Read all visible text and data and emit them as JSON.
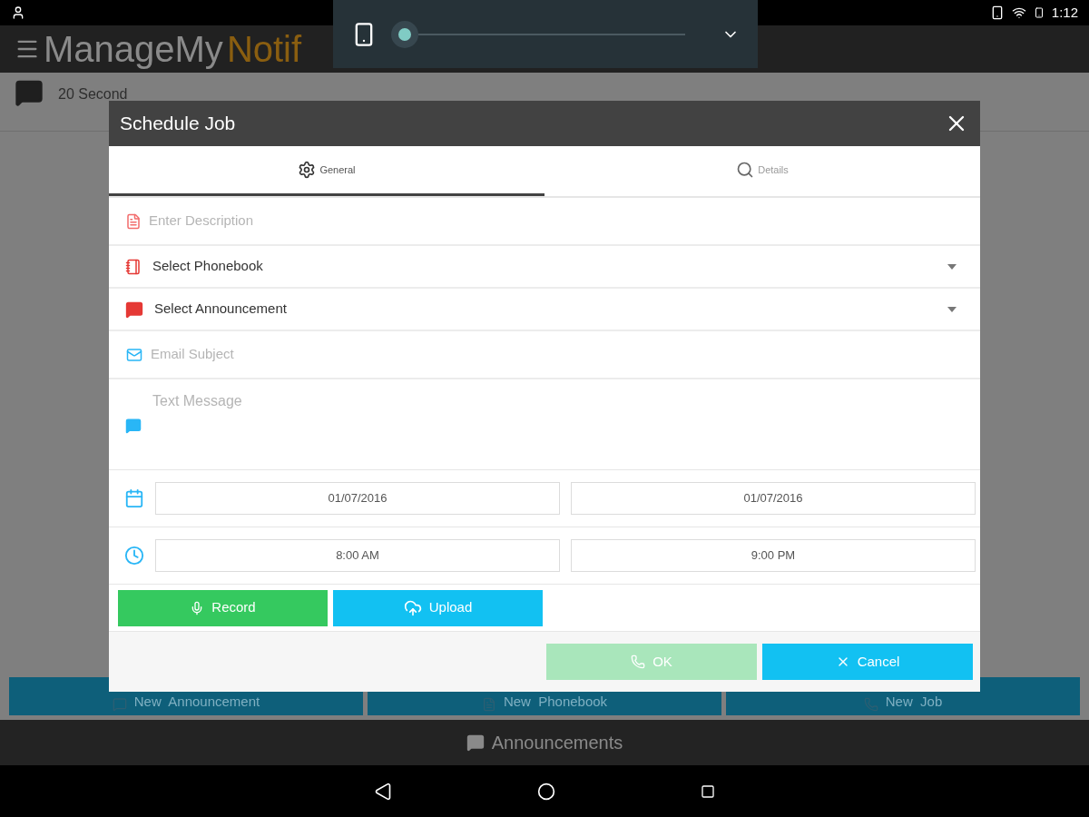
{
  "status_bar": {
    "time": "1:12"
  },
  "volume_panel": {
    "level": 0
  },
  "app_bar": {
    "title_part_1": "ManageMy",
    "title_part_2": "Notif"
  },
  "list": [
    {
      "text": "20 Second"
    }
  ],
  "actions": [
    {
      "kind": "announcement",
      "label": "New  Announcement"
    },
    {
      "kind": "phonebook",
      "label": "New  Phonebook"
    },
    {
      "kind": "job",
      "label": "New  Job"
    }
  ],
  "bottom_tab": {
    "label": "Announcements"
  },
  "dialog": {
    "title": "Schedule Job",
    "tabs": [
      {
        "kind": "gear",
        "label": "General",
        "selected": true
      },
      {
        "kind": "search",
        "label": "Details",
        "selected": false
      }
    ],
    "fields": [
      {
        "kind": "input",
        "placeholder": "Enter Description"
      },
      {
        "kind": "select",
        "value": "Select Phonebook"
      },
      {
        "kind": "select",
        "value": "Select Announcement"
      },
      {
        "kind": "input",
        "placeholder": "Email Subject"
      },
      {
        "kind": "textarea",
        "placeholder": "Text Message"
      }
    ],
    "date_rows": [
      {
        "kind": "date",
        "values": [
          "01/07/2016",
          "01/07/2016"
        ]
      },
      {
        "kind": "time",
        "values": [
          "8:00 AM",
          "9:00 PM"
        ]
      }
    ],
    "media_buttons": [
      {
        "kind": "record",
        "label": "Record"
      },
      {
        "kind": "upload",
        "label": "Upload"
      }
    ],
    "footer_buttons": [
      {
        "kind": "ok",
        "label": "OK",
        "disabled": true
      },
      {
        "kind": "cancel",
        "label": "Cancel",
        "disabled": false
      }
    ]
  }
}
